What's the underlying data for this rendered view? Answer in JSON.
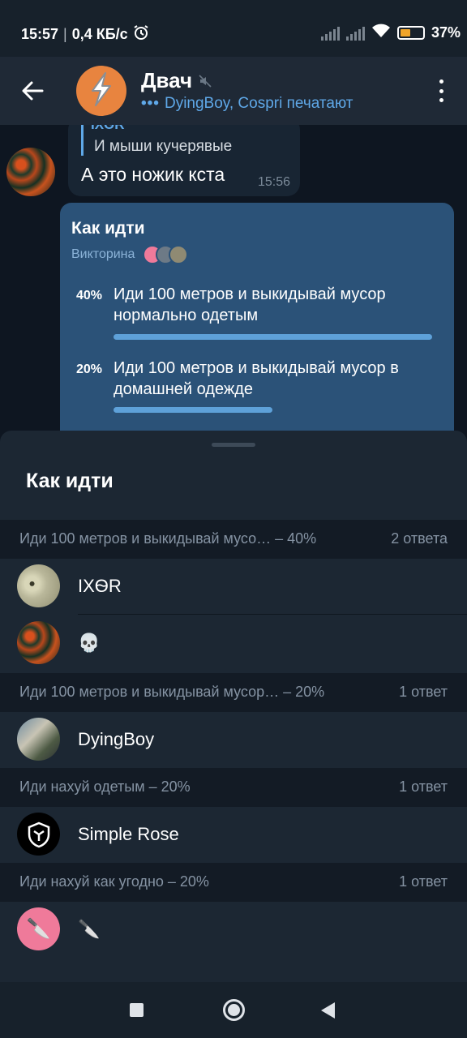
{
  "status_bar": {
    "time": "15:57",
    "speed": "0,4 КБ/с",
    "battery": "37%",
    "icons": [
      "alarm-icon",
      "signal-icon",
      "signal-icon",
      "wifi-icon",
      "battery-icon"
    ]
  },
  "header": {
    "title": "Двач",
    "typing": "DyingBoy, Cospri печатают",
    "icons": [
      "back-arrow-icon",
      "lightning-icon",
      "muted-icon",
      "more-vert-icon"
    ],
    "avatar_color": "#e8843f"
  },
  "chat": {
    "reply_name": "IXѲR",
    "reply_text": "И мыши кучерявые",
    "message": "А это ножик кста",
    "time": "15:56"
  },
  "poll": {
    "question": "Как идти",
    "type": "Викторина",
    "options": [
      {
        "percent": "40%",
        "text": "Иди 100 метров и выкидывай мусор нормально одетым",
        "fill": 0.4
      },
      {
        "percent": "20%",
        "text": "Иди 100 метров и выкидывай мусор в домашней одежде",
        "fill": 0.2
      }
    ]
  },
  "sheet": {
    "title": "Как идти",
    "sections": [
      {
        "label": "Иди 100 метров и выкидывай мусо… – 40%",
        "count": "2 ответа",
        "voters": [
          {
            "name": "IXѲR"
          },
          {
            "name": "💀"
          }
        ]
      },
      {
        "label": "Иди 100 метров и выкидывай мусор… – 20%",
        "count": "1 ответ",
        "voters": [
          {
            "name": "DyingBoy"
          }
        ]
      },
      {
        "label": "Иди нахуй одетым – 20%",
        "count": "1 ответ",
        "voters": [
          {
            "name": "Simple Rose"
          }
        ]
      },
      {
        "label": "Иди нахуй как угодно – 20%",
        "count": "1 ответ",
        "voters": [
          {
            "name": "🔪"
          }
        ]
      }
    ]
  },
  "colors": {
    "accent": "#5fa8e8",
    "poll_bg": "#2b5278",
    "bar": "#5ea1d9"
  }
}
